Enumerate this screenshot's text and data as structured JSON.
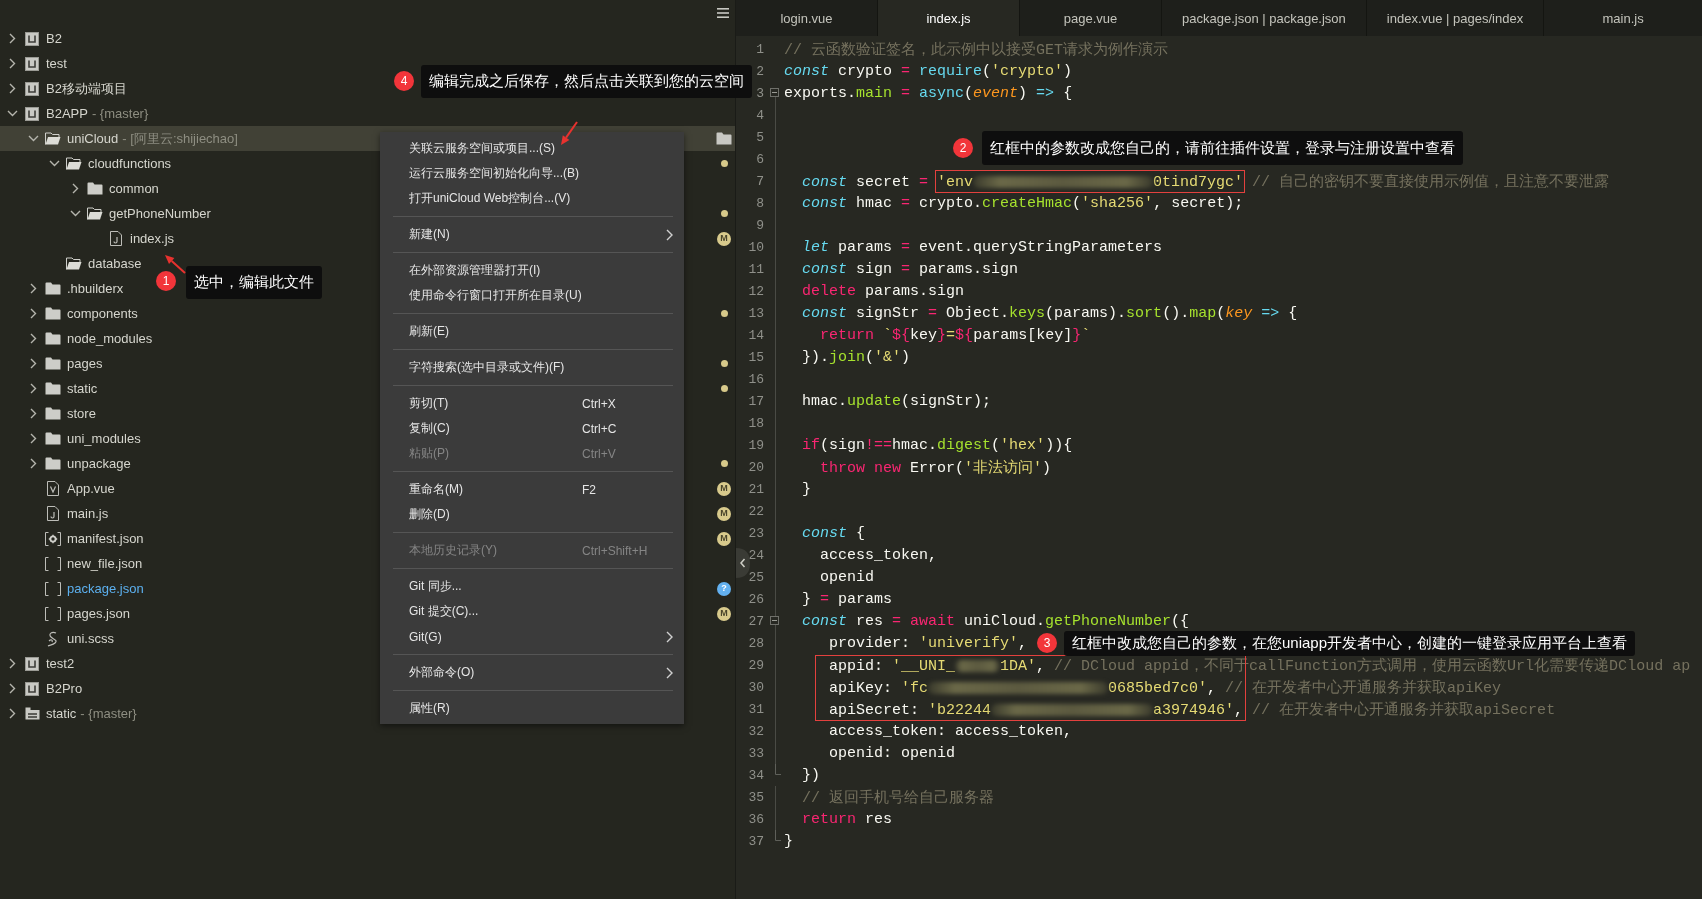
{
  "sidebar": {
    "tree": [
      {
        "label": "B2",
        "kind": "project",
        "expanded": false,
        "selected": false
      },
      {
        "label": "test",
        "kind": "project",
        "expanded": false,
        "selected": false
      },
      {
        "label": "B2移动端项目",
        "kind": "project",
        "expanded": false,
        "selected": false
      },
      {
        "label": "B2APP",
        "detail": "- {master}",
        "kind": "project",
        "expanded": true,
        "selected": false,
        "children": [
          {
            "label": "uniCloud",
            "detail": "- [阿里云:shijiechao]",
            "kind": "folder",
            "expanded": true,
            "selected": true,
            "children": [
              {
                "label": "cloudfunctions",
                "kind": "folder",
                "expanded": true,
                "selected": false,
                "marker": {
                  "kind": "dot"
                },
                "children": [
                  {
                    "label": "common",
                    "kind": "folder",
                    "expanded": false,
                    "selected": false
                  },
                  {
                    "label": "getPhoneNumber",
                    "kind": "folder",
                    "expanded": true,
                    "selected": false,
                    "marker": {
                      "kind": "dot"
                    },
                    "children": [
                      {
                        "label": "index.js",
                        "kind": "js",
                        "selected": false,
                        "marker": {
                          "kind": "modified",
                          "text": "M"
                        }
                      }
                    ]
                  }
                ]
              },
              {
                "label": "database",
                "kind": "folder",
                "selected": false
              }
            ]
          },
          {
            "label": ".hbuilderx",
            "kind": "folder",
            "expanded": false,
            "selected": false
          },
          {
            "label": "components",
            "kind": "folder",
            "expanded": false,
            "selected": false,
            "marker": {
              "kind": "dot"
            }
          },
          {
            "label": "node_modules",
            "kind": "folder",
            "expanded": false,
            "selected": false
          },
          {
            "label": "pages",
            "kind": "folder",
            "expanded": false,
            "selected": false,
            "marker": {
              "kind": "dot"
            }
          },
          {
            "label": "static",
            "kind": "folder",
            "expanded": false,
            "selected": false,
            "marker": {
              "kind": "dot"
            }
          },
          {
            "label": "store",
            "kind": "folder",
            "expanded": false,
            "selected": false
          },
          {
            "label": "uni_modules",
            "kind": "folder",
            "expanded": false,
            "selected": false
          },
          {
            "label": "unpackage",
            "kind": "folder",
            "expanded": false,
            "selected": false,
            "marker": {
              "kind": "dot"
            }
          },
          {
            "label": "App.vue",
            "kind": "vue",
            "selected": false,
            "marker": {
              "kind": "modified",
              "text": "M"
            }
          },
          {
            "label": "main.js",
            "kind": "js",
            "selected": false,
            "marker": {
              "kind": "modified",
              "text": "M"
            }
          },
          {
            "label": "manifest.json",
            "kind": "manifest",
            "selected": false,
            "marker": {
              "kind": "modified",
              "text": "M"
            }
          },
          {
            "label": "new_file.json",
            "kind": "json",
            "selected": false
          },
          {
            "label": "package.json",
            "kind": "json",
            "selected": false,
            "marker": {
              "kind": "untracked",
              "text": "?"
            }
          },
          {
            "label": "pages.json",
            "kind": "json",
            "selected": false,
            "marker": {
              "kind": "modified",
              "text": "M"
            }
          },
          {
            "label": "uni.scss",
            "kind": "scss",
            "selected": false
          }
        ]
      },
      {
        "label": "test2",
        "kind": "project",
        "expanded": false,
        "selected": false
      },
      {
        "label": "B2Pro",
        "kind": "project",
        "expanded": false,
        "selected": false
      },
      {
        "label": "static",
        "detail": "- {master}",
        "kind": "repo",
        "expanded": false,
        "selected": false
      }
    ]
  },
  "context_menu": {
    "groups": [
      [
        {
          "label": "关联云服务空间或项目...(S)",
          "disabled": false,
          "submenu": false
        },
        {
          "label": "运行云服务空间初始化向导...(B)",
          "disabled": false,
          "submenu": false
        },
        {
          "label": "打开uniCloud Web控制台...(V)",
          "disabled": false,
          "submenu": false
        }
      ],
      [
        {
          "label": "新建(N)",
          "disabled": false,
          "submenu": true
        }
      ],
      [
        {
          "label": "在外部资源管理器打开(I)",
          "disabled": false,
          "submenu": false
        },
        {
          "label": "使用命令行窗口打开所在目录(U)",
          "disabled": false,
          "submenu": false
        }
      ],
      [
        {
          "label": "刷新(E)",
          "disabled": false,
          "submenu": false
        }
      ],
      [
        {
          "label": "字符搜索(选中目录或文件)(F)",
          "disabled": false,
          "submenu": false
        }
      ],
      [
        {
          "label": "剪切(T)",
          "shortcut": "Ctrl+X",
          "disabled": false,
          "submenu": false
        },
        {
          "label": "复制(C)",
          "shortcut": "Ctrl+C",
          "disabled": false,
          "submenu": false
        },
        {
          "label": "粘贴(P)",
          "shortcut": "Ctrl+V",
          "disabled": true,
          "submenu": false
        }
      ],
      [
        {
          "label": "重命名(M)",
          "shortcut": "F2",
          "disabled": false,
          "submenu": false
        },
        {
          "label": "删除(D)",
          "disabled": false,
          "submenu": false
        }
      ],
      [
        {
          "label": "本地历史记录(Y)",
          "shortcut": "Ctrl+Shift+H",
          "disabled": true,
          "submenu": false
        }
      ],
      [
        {
          "label": "Git 同步...",
          "disabled": false,
          "submenu": false
        },
        {
          "label": "Git 提交(C)...",
          "disabled": false,
          "submenu": false
        },
        {
          "label": "Git(G)",
          "disabled": false,
          "submenu": true
        }
      ],
      [
        {
          "label": "外部命令(O)",
          "disabled": false,
          "submenu": true
        }
      ],
      [
        {
          "label": "属性(R)",
          "disabled": false,
          "submenu": false
        }
      ]
    ]
  },
  "editor": {
    "tabs": [
      {
        "label": "login.vue",
        "selected": false
      },
      {
        "label": "index.js",
        "selected": true
      },
      {
        "label": "page.vue",
        "selected": false
      },
      {
        "label": "package.json | package.json",
        "selected": false
      },
      {
        "label": "index.vue | pages/index",
        "selected": false
      },
      {
        "label": "main.js",
        "selected": false
      }
    ],
    "lines": [
      {
        "number": "1",
        "tokens": [
          {
            "kind": "comment",
            "text": "// 云函数验证签名，此示例中以接受GET请求为例作演示"
          }
        ]
      },
      {
        "number": "2",
        "tokens": [
          {
            "kind": "storage",
            "text": "const"
          },
          {
            "kind": "plain",
            "text": " crypto "
          },
          {
            "kind": "keyword",
            "text": "= "
          },
          {
            "kind": "support",
            "text": "require"
          },
          {
            "kind": "plain",
            "text": "("
          },
          {
            "kind": "string",
            "text": "'crypto'"
          },
          {
            "kind": "plain",
            "text": ")"
          }
        ]
      },
      {
        "number": "3",
        "expanded": true,
        "tokens": [
          {
            "kind": "plain",
            "text": "exports."
          },
          {
            "kind": "function",
            "text": "main"
          },
          {
            "kind": "keyword",
            "text": " = "
          },
          {
            "kind": "support",
            "text": "async"
          },
          {
            "kind": "plain",
            "text": "("
          },
          {
            "kind": "param",
            "text": "event"
          },
          {
            "kind": "plain",
            "text": ") "
          },
          {
            "kind": "support",
            "text": "=>"
          },
          {
            "kind": "plain",
            "text": " {"
          }
        ]
      },
      {
        "number": "4"
      },
      {
        "number": "5"
      },
      {
        "number": "6"
      },
      {
        "number": "7",
        "tokens": [
          {
            "kind": "storage",
            "text": "  const"
          },
          {
            "kind": "plain",
            "text": " secret "
          },
          {
            "kind": "keyword",
            "text": "= "
          },
          {
            "kind": "string",
            "text": "'env"
          },
          {
            "kind": "redacted-long"
          },
          {
            "kind": "string",
            "text": "0tind7ygc'"
          },
          {
            "kind": "comment",
            "text": " // 自己的密钥不要直接使用示例值，且注意不要泄露"
          }
        ]
      },
      {
        "number": "8",
        "tokens": [
          {
            "kind": "storage",
            "text": "  const"
          },
          {
            "kind": "plain",
            "text": " hmac "
          },
          {
            "kind": "keyword",
            "text": "="
          },
          {
            "kind": "plain",
            "text": " crypto."
          },
          {
            "kind": "function",
            "text": "createHmac"
          },
          {
            "kind": "plain",
            "text": "("
          },
          {
            "kind": "string",
            "text": "'sha256'"
          },
          {
            "kind": "plain",
            "text": ", secret);"
          }
        ]
      },
      {
        "number": "9"
      },
      {
        "number": "10",
        "tokens": [
          {
            "kind": "storage",
            "text": "  let"
          },
          {
            "kind": "plain",
            "text": " params "
          },
          {
            "kind": "keyword",
            "text": "="
          },
          {
            "kind": "plain",
            "text": " event.queryStringParameters"
          }
        ]
      },
      {
        "number": "11",
        "tokens": [
          {
            "kind": "storage",
            "text": "  const"
          },
          {
            "kind": "plain",
            "text": " sign "
          },
          {
            "kind": "keyword",
            "text": "="
          },
          {
            "kind": "plain",
            "text": " params.sign"
          }
        ]
      },
      {
        "number": "12",
        "tokens": [
          {
            "kind": "keyword",
            "text": "  delete"
          },
          {
            "kind": "plain",
            "text": " params.sign"
          }
        ]
      },
      {
        "number": "13",
        "tokens": [
          {
            "kind": "storage",
            "text": "  const"
          },
          {
            "kind": "plain",
            "text": " signStr "
          },
          {
            "kind": "keyword",
            "text": "="
          },
          {
            "kind": "plain",
            "text": " Object."
          },
          {
            "kind": "function",
            "text": "keys"
          },
          {
            "kind": "plain",
            "text": "(params)."
          },
          {
            "kind": "function",
            "text": "sort"
          },
          {
            "kind": "plain",
            "text": "()."
          },
          {
            "kind": "function",
            "text": "map"
          },
          {
            "kind": "plain",
            "text": "("
          },
          {
            "kind": "param",
            "text": "key"
          },
          {
            "kind": "support",
            "text": " =>"
          },
          {
            "kind": "plain",
            "text": " {"
          }
        ]
      },
      {
        "number": "14",
        "tokens": [
          {
            "kind": "keyword",
            "text": "    return"
          },
          {
            "kind": "string",
            "text": " `"
          },
          {
            "kind": "keyword",
            "text": "${"
          },
          {
            "kind": "plain",
            "text": "key"
          },
          {
            "kind": "keyword",
            "text": "}"
          },
          {
            "kind": "string",
            "text": "="
          },
          {
            "kind": "keyword",
            "text": "${"
          },
          {
            "kind": "plain",
            "text": "params[key]"
          },
          {
            "kind": "keyword",
            "text": "}"
          },
          {
            "kind": "string",
            "text": "`"
          }
        ]
      },
      {
        "number": "15",
        "tokens": [
          {
            "kind": "plain",
            "text": "  })."
          },
          {
            "kind": "function",
            "text": "join"
          },
          {
            "kind": "plain",
            "text": "("
          },
          {
            "kind": "string",
            "text": "'&'"
          },
          {
            "kind": "plain",
            "text": ")"
          }
        ]
      },
      {
        "number": "16"
      },
      {
        "number": "17",
        "tokens": [
          {
            "kind": "plain",
            "text": "  hmac."
          },
          {
            "kind": "function",
            "text": "update"
          },
          {
            "kind": "plain",
            "text": "(signStr);"
          }
        ]
      },
      {
        "number": "18"
      },
      {
        "number": "19",
        "tokens": [
          {
            "kind": "keyword",
            "text": "  if"
          },
          {
            "kind": "plain",
            "text": "(sign"
          },
          {
            "kind": "keyword",
            "text": "!=="
          },
          {
            "kind": "plain",
            "text": "hmac."
          },
          {
            "kind": "function",
            "text": "digest"
          },
          {
            "kind": "plain",
            "text": "("
          },
          {
            "kind": "string",
            "text": "'hex'"
          },
          {
            "kind": "plain",
            "text": ")){"
          }
        ]
      },
      {
        "number": "20",
        "tokens": [
          {
            "kind": "keyword",
            "text": "    throw new"
          },
          {
            "kind": "plain",
            "text": " Error("
          },
          {
            "kind": "string",
            "text": "'非法访问'"
          },
          {
            "kind": "plain",
            "text": ")"
          }
        ]
      },
      {
        "number": "21",
        "tokens": [
          {
            "kind": "plain",
            "text": "  }"
          }
        ]
      },
      {
        "number": "22"
      },
      {
        "number": "23",
        "tokens": [
          {
            "kind": "storage",
            "text": "  const"
          },
          {
            "kind": "plain",
            "text": " {"
          }
        ]
      },
      {
        "number": "24",
        "tokens": [
          {
            "kind": "plain",
            "text": "    access_token,"
          }
        ]
      },
      {
        "number": "25",
        "tokens": [
          {
            "kind": "plain",
            "text": "    openid"
          }
        ]
      },
      {
        "number": "26",
        "tokens": [
          {
            "kind": "plain",
            "text": "  } "
          },
          {
            "kind": "keyword",
            "text": "="
          },
          {
            "kind": "plain",
            "text": " params"
          }
        ]
      },
      {
        "number": "27",
        "expanded": true,
        "tokens": [
          {
            "kind": "storage",
            "text": "  const"
          },
          {
            "kind": "plain",
            "text": " res "
          },
          {
            "kind": "keyword",
            "text": "= await"
          },
          {
            "kind": "plain",
            "text": " uniCloud."
          },
          {
            "kind": "function",
            "text": "getPhoneNumber"
          },
          {
            "kind": "plain",
            "text": "({"
          }
        ]
      },
      {
        "number": "28",
        "tokens": [
          {
            "kind": "plain",
            "text": "     provider: "
          },
          {
            "kind": "string",
            "text": "'univerify'"
          },
          {
            "kind": "plain",
            "text": ","
          }
        ]
      },
      {
        "number": "29",
        "tokens": [
          {
            "kind": "plain",
            "text": "     appid: "
          },
          {
            "kind": "string",
            "text": "'__UNI_"
          },
          {
            "kind": "redacted-short"
          },
          {
            "kind": "string",
            "text": "1DA'"
          },
          {
            "kind": "plain",
            "text": ", "
          },
          {
            "kind": "comment",
            "text": "// DCloud appid，不同于callFunction方式调用，使用云函数Url化需要传递DCloud ap"
          }
        ]
      },
      {
        "number": "30",
        "tokens": [
          {
            "kind": "plain",
            "text": "     apiKey: "
          },
          {
            "kind": "string",
            "text": "'fc"
          },
          {
            "kind": "redacted-long"
          },
          {
            "kind": "string",
            "text": "0685bed7c0'"
          },
          {
            "kind": "plain",
            "text": ", "
          },
          {
            "kind": "comment",
            "text": "// 在开发者中心开通服务并获取apiKey"
          }
        ]
      },
      {
        "number": "31",
        "tokens": [
          {
            "kind": "plain",
            "text": "     apiSecret: "
          },
          {
            "kind": "string",
            "text": "'b22244"
          },
          {
            "kind": "redacted-medium"
          },
          {
            "kind": "string",
            "text": "a3974946'"
          },
          {
            "kind": "plain",
            "text": ", "
          },
          {
            "kind": "comment",
            "text": "// 在开发者中心开通服务并获取apiSecret"
          }
        ]
      },
      {
        "number": "32",
        "tokens": [
          {
            "kind": "plain",
            "text": "     access_token: access_token,"
          }
        ]
      },
      {
        "number": "33",
        "tokens": [
          {
            "kind": "plain",
            "text": "     openid: openid"
          }
        ]
      },
      {
        "number": "34",
        "fold_end": true,
        "tokens": [
          {
            "kind": "plain",
            "text": "  })"
          }
        ]
      },
      {
        "number": "35",
        "tokens": [
          {
            "kind": "comment",
            "text": "  // 返回手机号给自己服务器"
          }
        ]
      },
      {
        "number": "36",
        "tokens": [
          {
            "kind": "keyword",
            "text": "  return"
          },
          {
            "kind": "plain",
            "text": " res"
          }
        ]
      },
      {
        "number": "37",
        "fold_end": true,
        "tokens": [
          {
            "kind": "plain",
            "text": "}"
          }
        ]
      }
    ]
  },
  "annotations": [
    {
      "number": "1",
      "text": "选中，编辑此文件"
    },
    {
      "number": "2",
      "text": "红框中的参数改成您自己的，请前往插件设置，登录与注册设置中查看"
    },
    {
      "number": "3",
      "text": "红框中改成您自己的参数，在您uniapp开发者中心，创建的一键登录应用平台上查看"
    },
    {
      "number": "4",
      "text": "编辑完成之后保存，然后点击关联到您的云空间"
    }
  ]
}
